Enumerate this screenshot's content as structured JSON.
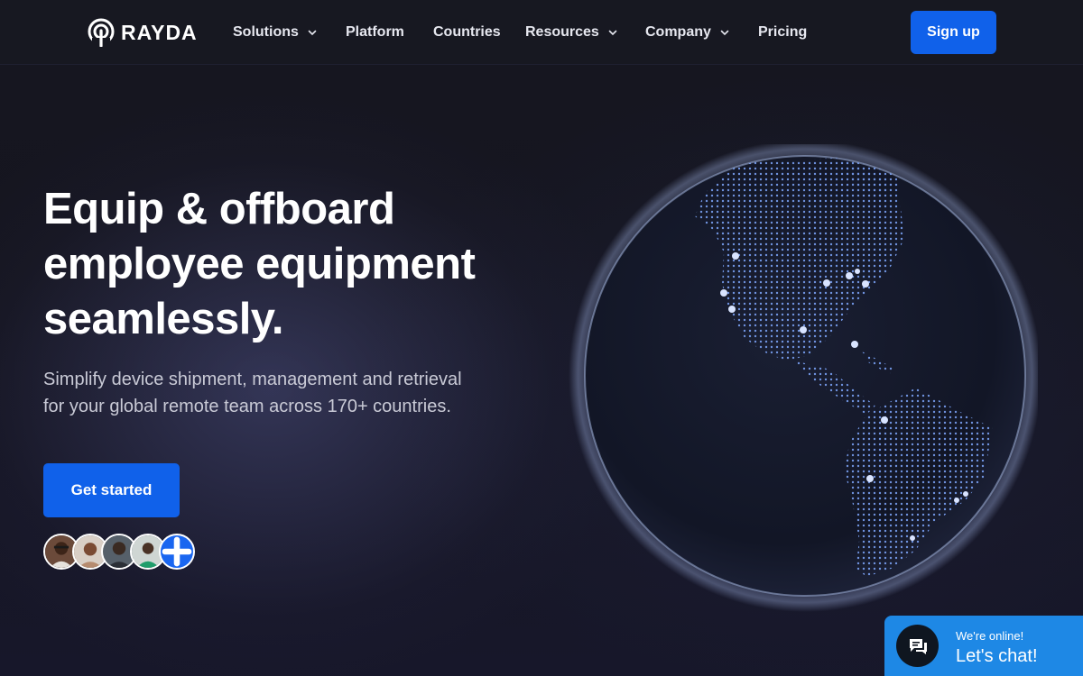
{
  "brand": {
    "name": "RAYDA"
  },
  "nav": {
    "items": [
      {
        "label": "Solutions",
        "dropdown": true
      },
      {
        "label": "Platform",
        "dropdown": false
      },
      {
        "label": "Countries",
        "dropdown": false
      },
      {
        "label": "Resources",
        "dropdown": true
      },
      {
        "label": "Company",
        "dropdown": true
      },
      {
        "label": "Pricing",
        "dropdown": false
      }
    ],
    "signup_label": "Sign up"
  },
  "hero": {
    "headline_lines": [
      "Equip & offboard",
      "employee equipment",
      "seamlessly."
    ],
    "subtitle_lines": [
      "Simplify device shipment, management and retrieval",
      "for your global remote team across 170+ countries."
    ],
    "cta_label": "Get started",
    "avatars": [
      "avatar-1",
      "avatar-2",
      "avatar-3",
      "avatar-4"
    ],
    "avatars_more_icon": "plus-icon"
  },
  "chat": {
    "status": "We're online!",
    "cta": "Let's chat!",
    "icon": "chat-bubble-icon"
  },
  "colors": {
    "accent": "#1061ea",
    "chat": "#1e88e5",
    "background": "#15151f"
  }
}
